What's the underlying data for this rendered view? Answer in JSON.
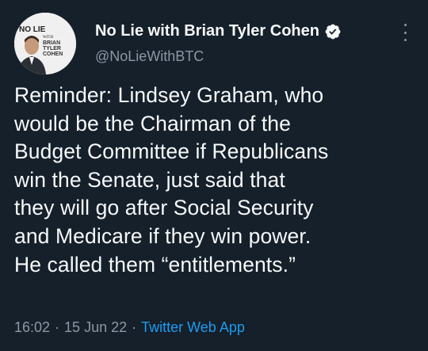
{
  "author": {
    "display_name": "No Lie with Brian Tyler Cohen",
    "handle": "@NoLieWithBTC",
    "avatar_logo_text": [
      "NO LIE",
      "WITH",
      "BRIAN",
      "TYLER",
      "COHEN"
    ]
  },
  "tweet": {
    "lines": [
      "Reminder: Lindsey Graham, who",
      "would be the Chairman of the",
      "Budget Committee if Republicans",
      "win the Senate, just said that",
      "they will go after Social Security",
      "and Medicare if they win power.",
      "He called them “entitlements.”"
    ],
    "time": "16:02",
    "date": "15 Jun 22",
    "separator": "·",
    "source": "Twitter Web App"
  },
  "colors": {
    "background": "#15202b",
    "text": "#f7f9f9",
    "muted": "#8b98a5",
    "link": "#1d9bf0"
  },
  "icons": {
    "verified": "verified-badge-icon",
    "more": "more-options-icon"
  }
}
